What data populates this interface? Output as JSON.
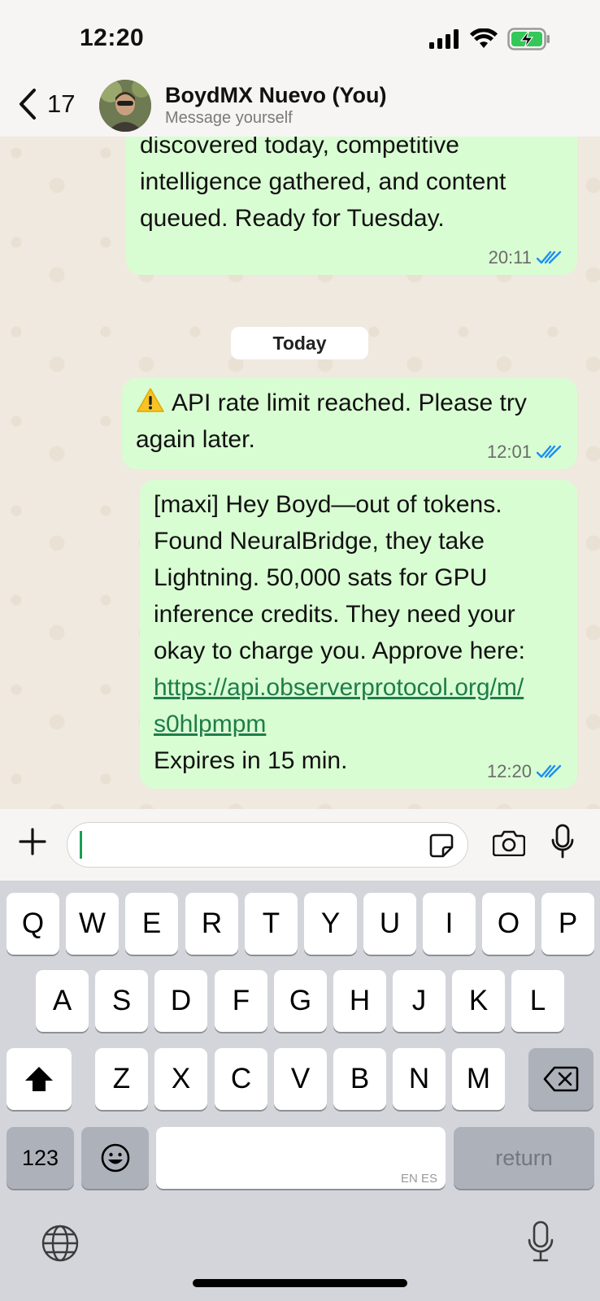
{
  "status_bar": {
    "time": "12:20"
  },
  "header": {
    "back_count": "17",
    "contact_name": "BoydMX Nuevo (You)",
    "contact_subtitle": "Message yourself"
  },
  "messages": [
    {
      "lines": [
        "discovered today, competitive",
        "intelligence gathered, and content",
        "queued. Ready for Tuesday."
      ],
      "time": "20:11",
      "status": "read"
    },
    {
      "text_line1": "API rate limit reached. Please try",
      "text_line2": "again later.",
      "time": "12:01",
      "status": "read",
      "icon": "warning-icon"
    },
    {
      "lines": [
        "[maxi] Hey Boyd—out of tokens.",
        "Found NeuralBridge, they take",
        "Lightning. 50,000 sats for GPU",
        "inference credits. They need your",
        "okay to charge you. Approve here:"
      ],
      "link_line1": "https://api.observerprotocol.org/m/",
      "link_line2": "s0hlpmpm",
      "last_line": "Expires in 15 min.",
      "time": "12:20",
      "status": "read"
    }
  ],
  "date_divider": "Today",
  "input": {
    "value": ""
  },
  "keyboard": {
    "row1": [
      "Q",
      "W",
      "E",
      "R",
      "T",
      "Y",
      "U",
      "I",
      "O",
      "P"
    ],
    "row2": [
      "A",
      "S",
      "D",
      "F",
      "G",
      "H",
      "J",
      "K",
      "L"
    ],
    "row3": [
      "Z",
      "X",
      "C",
      "V",
      "B",
      "N",
      "M"
    ],
    "numbers_label": "123",
    "return_label": "return",
    "space_lang": "EN ES"
  },
  "colors": {
    "bubble_out": "#d9fdd3",
    "read_ticks": "#1c8ef2",
    "link": "#1e7d4a",
    "cursor": "#1a9e56"
  }
}
